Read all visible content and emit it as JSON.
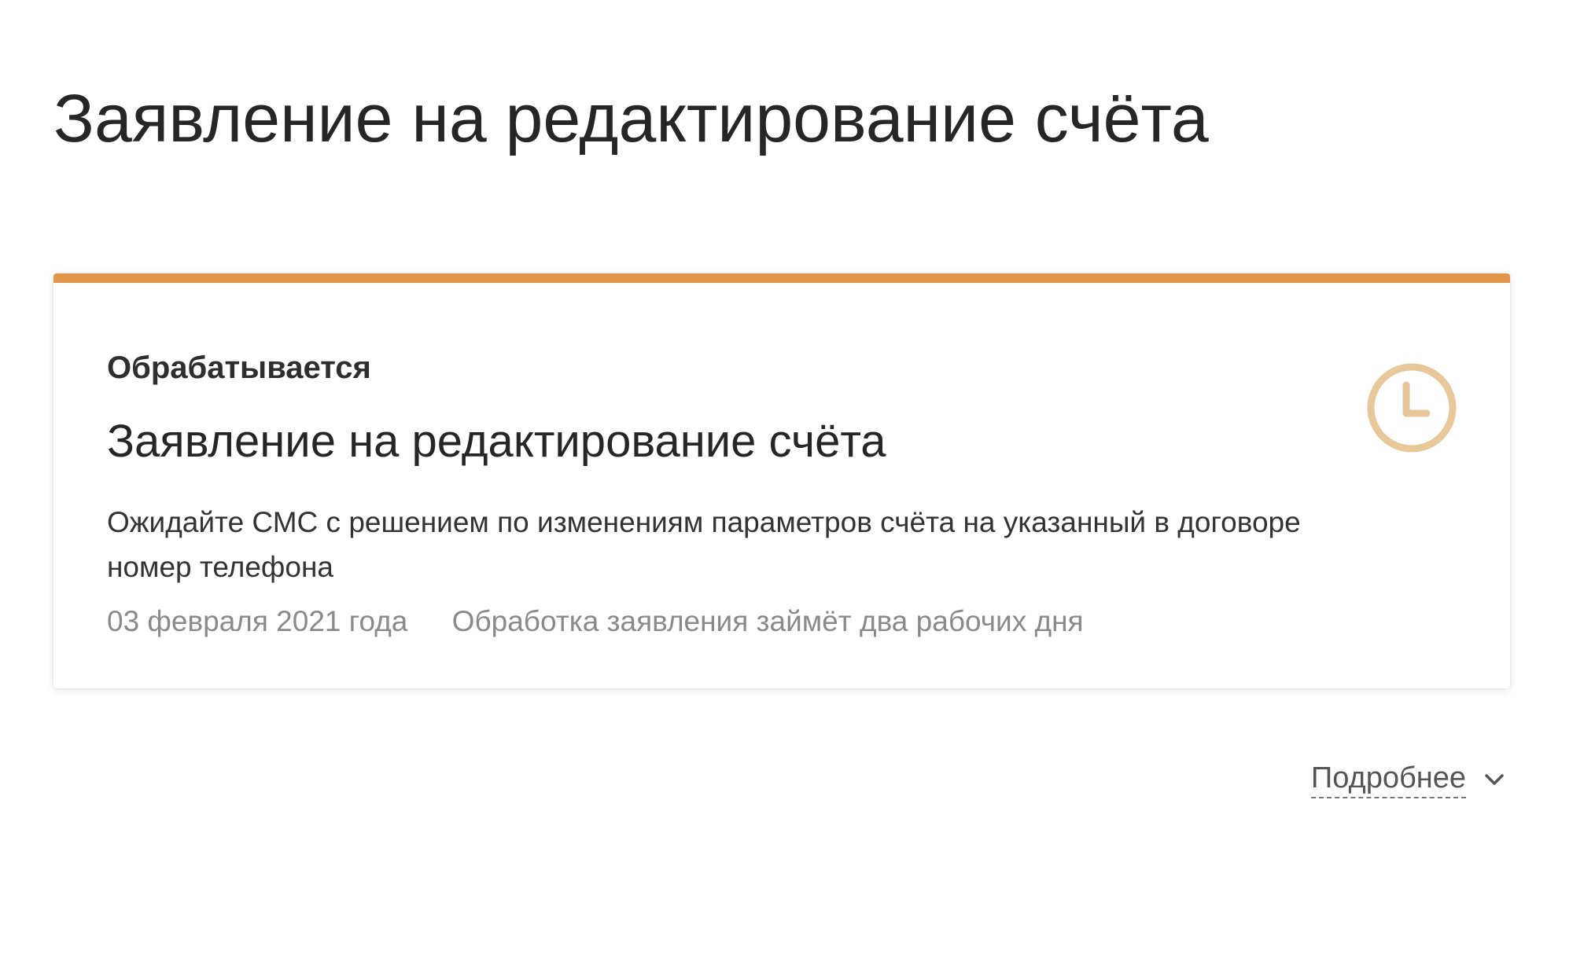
{
  "page": {
    "title": "Заявление на редактирование счёта"
  },
  "status_card": {
    "accent_color": "#e1964a",
    "status_label": "Обрабатывается",
    "title": "Заявление на редактирование счёта",
    "description": "Ожидайте СМС с решением по изменениям параметров счёта на указанный в договоре номер телефона",
    "date": "03 февраля 2021 года",
    "processing_note": "Обработка заявления займёт два рабочих дня",
    "icon": "clock-icon"
  },
  "details": {
    "label": "Подробнее",
    "icon": "chevron-down-icon"
  }
}
